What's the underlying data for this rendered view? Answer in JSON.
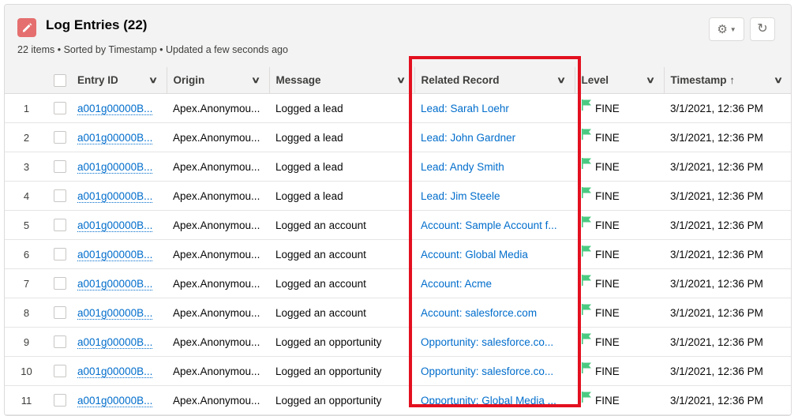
{
  "header": {
    "title": "Log Entries (22)",
    "subtitle": "22 items • Sorted by Timestamp • Updated a few seconds ago",
    "icon": "edit-pencil-icon",
    "buttons": {
      "settings": "gear-icon",
      "refresh": "refresh-icon"
    }
  },
  "columns": {
    "entry_id": "Entry ID",
    "origin": "Origin",
    "message": "Message",
    "related_record": "Related Record",
    "level": "Level",
    "timestamp": "Timestamp",
    "timestamp_sort": "↑"
  },
  "rows": [
    {
      "num": "1",
      "entry_id": "a001g00000B...",
      "origin": "Apex.Anonymou...",
      "message": "Logged a lead",
      "related": "Lead: Sarah Loehr",
      "level": "FINE",
      "timestamp": "3/1/2021, 12:36 PM"
    },
    {
      "num": "2",
      "entry_id": "a001g00000B...",
      "origin": "Apex.Anonymou...",
      "message": "Logged a lead",
      "related": "Lead: John Gardner",
      "level": "FINE",
      "timestamp": "3/1/2021, 12:36 PM"
    },
    {
      "num": "3",
      "entry_id": "a001g00000B...",
      "origin": "Apex.Anonymou...",
      "message": "Logged a lead",
      "related": "Lead: Andy Smith",
      "level": "FINE",
      "timestamp": "3/1/2021, 12:36 PM"
    },
    {
      "num": "4",
      "entry_id": "a001g00000B...",
      "origin": "Apex.Anonymou...",
      "message": "Logged a lead",
      "related": "Lead: Jim Steele",
      "level": "FINE",
      "timestamp": "3/1/2021, 12:36 PM"
    },
    {
      "num": "5",
      "entry_id": "a001g00000B...",
      "origin": "Apex.Anonymou...",
      "message": "Logged an account",
      "related": "Account: Sample Account f...",
      "level": "FINE",
      "timestamp": "3/1/2021, 12:36 PM"
    },
    {
      "num": "6",
      "entry_id": "a001g00000B...",
      "origin": "Apex.Anonymou...",
      "message": "Logged an account",
      "related": "Account: Global Media",
      "level": "FINE",
      "timestamp": "3/1/2021, 12:36 PM"
    },
    {
      "num": "7",
      "entry_id": "a001g00000B...",
      "origin": "Apex.Anonymou...",
      "message": "Logged an account",
      "related": "Account: Acme",
      "level": "FINE",
      "timestamp": "3/1/2021, 12:36 PM"
    },
    {
      "num": "8",
      "entry_id": "a001g00000B...",
      "origin": "Apex.Anonymou...",
      "message": "Logged an account",
      "related": "Account: salesforce.com",
      "level": "FINE",
      "timestamp": "3/1/2021, 12:36 PM"
    },
    {
      "num": "9",
      "entry_id": "a001g00000B...",
      "origin": "Apex.Anonymou...",
      "message": "Logged an opportunity",
      "related": "Opportunity: salesforce.co...",
      "level": "FINE",
      "timestamp": "3/1/2021, 12:36 PM"
    },
    {
      "num": "10",
      "entry_id": "a001g00000B...",
      "origin": "Apex.Anonymou...",
      "message": "Logged an opportunity",
      "related": "Opportunity: salesforce.co...",
      "level": "FINE",
      "timestamp": "3/1/2021, 12:36 PM"
    },
    {
      "num": "11",
      "entry_id": "a001g00000B...",
      "origin": "Apex.Anonymou...",
      "message": "Logged an opportunity",
      "related": "Opportunity: Global Media ...",
      "level": "FINE",
      "timestamp": "3/1/2021, 12:36 PM"
    }
  ],
  "colors": {
    "link": "#006dcc",
    "flag": "#4bca81",
    "highlight": "#e3101f",
    "icon_bg": "#e56f6f"
  }
}
